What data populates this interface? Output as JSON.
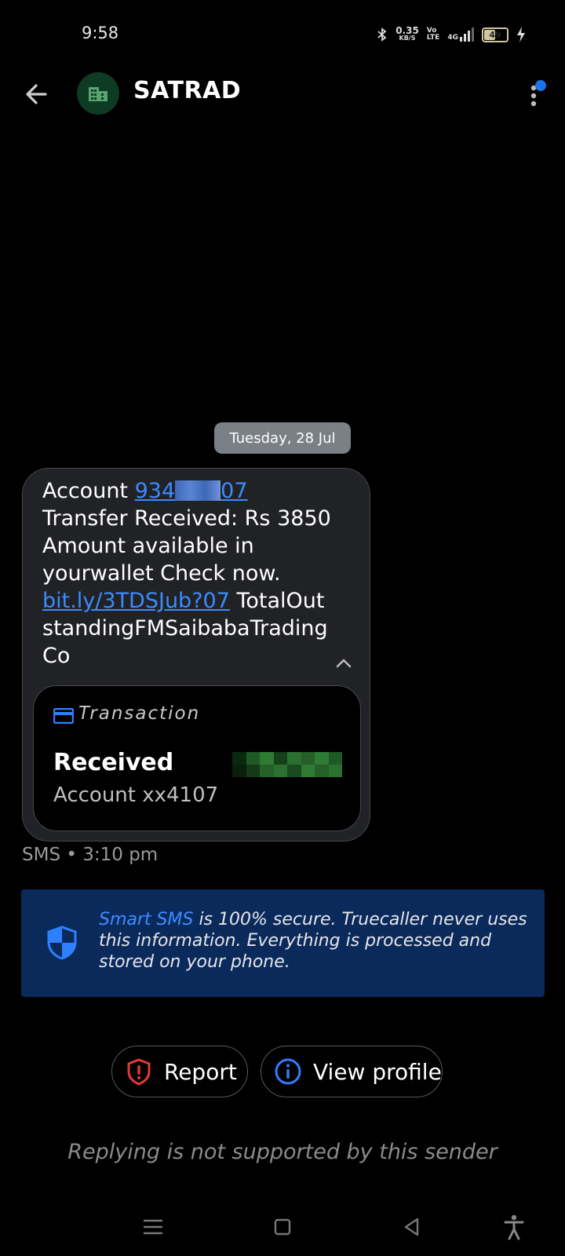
{
  "status": {
    "time": "9:58",
    "speed_value": "0.35",
    "speed_unit": "KB/S",
    "volte_top": "Vo",
    "volte_bottom": "LTE",
    "network": "4G",
    "battery": "49"
  },
  "header": {
    "title": "SATRAD",
    "icons": [
      "back-arrow-icon",
      "building-icon",
      "more-vert-icon"
    ]
  },
  "date_chip": "Tuesday, 28 Jul",
  "message": {
    "p1": "Account ",
    "acct_link_start": "934",
    "acct_link_end": "07",
    "p2": " Transfer Received: Rs 3850 Amount available in yourwallet Check now. ",
    "url": "bit.ly/3TDSJub?07",
    "p3": " TotalOutstandingFMSaibabaTradingCo"
  },
  "transaction_card": {
    "label": "Transaction",
    "status": "Received",
    "account": "Account xx4107"
  },
  "meta": "SMS • 3:10 pm",
  "banner": {
    "highlight": "Smart SMS",
    "text": " is 100% secure. Truecaller never uses this information. Everything is processed and stored on your phone."
  },
  "actions": {
    "report": "Report",
    "view_profile": "View profile"
  },
  "footer_note": "Replying is not supported by this sender",
  "colors": {
    "background": "#000000",
    "accent": "#3b8bff",
    "banner": "#0b2a5c",
    "report_red": "#e53935"
  }
}
